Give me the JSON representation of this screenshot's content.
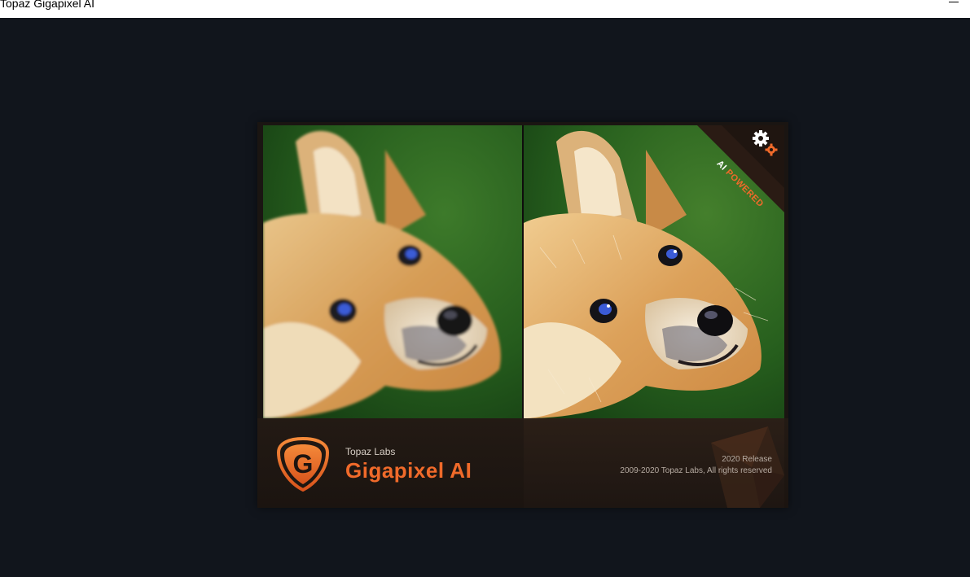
{
  "window": {
    "title": "Topaz Gigapixel AI"
  },
  "splash": {
    "company": "Topaz Labs",
    "product": "Gigapixel AI",
    "release": "2020 Release",
    "copyright": "2009-2020 Topaz Labs, All rights reserved",
    "badge_prefix": "AI",
    "badge_highlight": "POWERED",
    "logo_letter": "G",
    "accent_color": "#f06a2a",
    "left_image": "fox-photo-blurry",
    "right_image": "fox-photo-enhanced"
  },
  "icons": {
    "minimize": "minimize-icon",
    "logo": "gigapixel-logo-icon",
    "gears": "gear-icon"
  }
}
